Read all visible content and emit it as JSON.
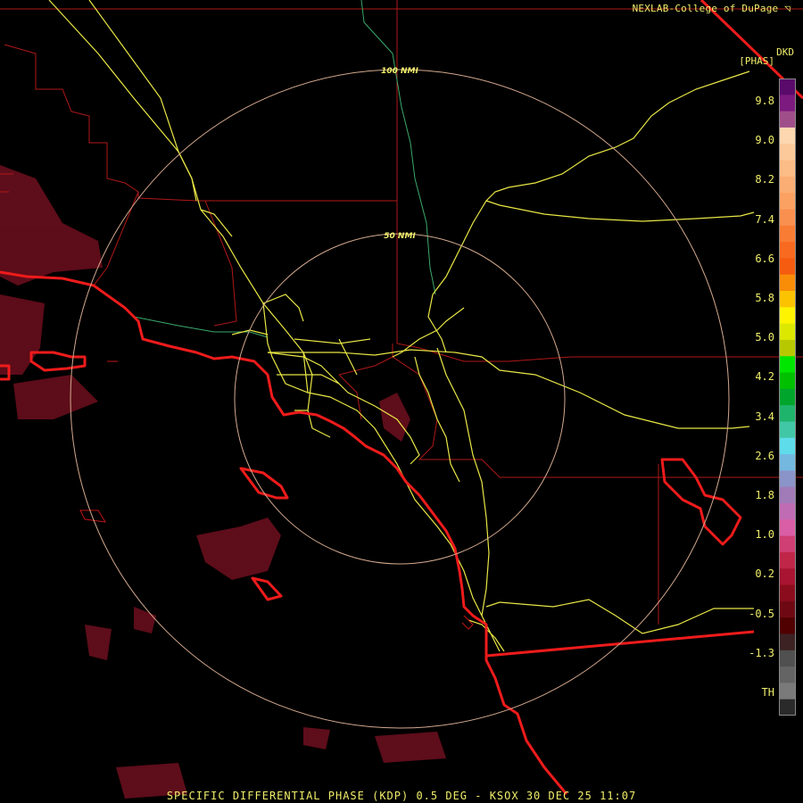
{
  "credit": "NEXLAB-College of DuPage",
  "product_code": "DKD",
  "units": "[PHAS]",
  "caption": "SPECIFIC DIFFERENTIAL PHASE (KDP) 0.5 DEG - KSOX 30 DEC 25 11:07",
  "range_rings": [
    {
      "label": "100 NMI"
    },
    {
      "label": "50 NMI"
    }
  ],
  "legend": {
    "ticks": [
      "9.8",
      "9.0",
      "8.2",
      "7.4",
      "6.6",
      "5.8",
      "5.0",
      "4.2",
      "3.4",
      "2.6",
      "1.8",
      "1.0",
      "0.2",
      "-0.5",
      "-1.3",
      "TH"
    ],
    "colors": [
      "#5a0a6a",
      "#7d1a7f",
      "#a04e8a",
      "#fcd7b0",
      "#fcc99a",
      "#fcbc86",
      "#fbae73",
      "#fba262",
      "#fa9050",
      "#f97c34",
      "#f86a1f",
      "#f65c10",
      "#f98d08",
      "#fcc300",
      "#fff400",
      "#dce800",
      "#b8c800",
      "#00e600",
      "#00c000",
      "#00a52c",
      "#1fb46b",
      "#41c7a6",
      "#5fdcea",
      "#74b8e0",
      "#8a94c8",
      "#a07bb8",
      "#c06cb4",
      "#da5ea6",
      "#cf3f72",
      "#c02648",
      "#a81432",
      "#8b0d1d",
      "#6e0913",
      "#500000",
      "#3c2222",
      "#505050",
      "#646464",
      "#7a7a7a",
      "#2a2a2a"
    ]
  }
}
